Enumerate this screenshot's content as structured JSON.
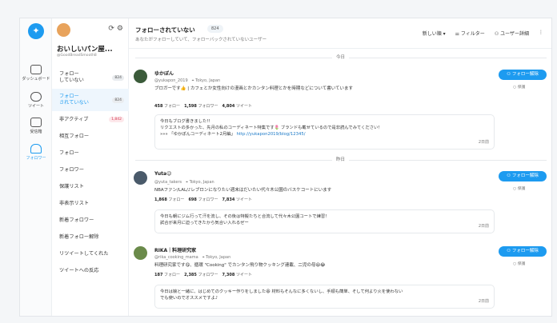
{
  "rail": {
    "logo_icon": "bird-logo-icon",
    "items": [
      {
        "icon": "chart-icon",
        "label": "ダッシュボード"
      },
      {
        "icon": "speech-bubble-icon",
        "label": "ツイート"
      },
      {
        "icon": "inbox-icon",
        "label": "受信箱"
      },
      {
        "icon": "people-icon",
        "label": "フォロワー"
      }
    ]
  },
  "account": {
    "name": "おいしいパン屋...",
    "handle": "@GoodBreadSmooth8",
    "refresh_icon": "refresh-icon",
    "settings_icon": "gear-icon"
  },
  "menu": [
    {
      "label": "フォロー\nしていない",
      "count": "824"
    },
    {
      "label": "フォロー\nされていない",
      "count": "824",
      "active": true
    },
    {
      "label": "非アクティブ",
      "count": "1,842",
      "alert": true
    },
    {
      "label": "相互フォロー"
    },
    {
      "label": "フォロー"
    },
    {
      "label": "フォロワー"
    },
    {
      "label": "保護リスト"
    },
    {
      "label": "非表示リスト"
    },
    {
      "label": "新着フォロワー"
    },
    {
      "label": "新着フォロー解除"
    },
    {
      "label": "リツイートしてくれた"
    },
    {
      "label": "ツイートへの反応"
    }
  ],
  "header": {
    "title": "フォローされていない",
    "count": "824",
    "subtitle": "あなたがフォローしていて、フォローバックされていないユーザー",
    "sort_label": "新しい順 ▾",
    "filter_label": "フィルター",
    "user_detail_label": "ユーザー詳細",
    "more_icon": "vertical-dots-icon"
  },
  "date_labels": [
    "今日",
    "昨日"
  ],
  "users": [
    {
      "name": "ゆかぽん",
      "handle": "@yukapon_2019",
      "location": "Tokyo, Japan",
      "bio": "ブロガーです👍 | カフェとか女性向けの漫画とかカンタン料理とかを時期などについて書いています",
      "following": "458",
      "followers": "1,598",
      "tweets": "4,804",
      "tweet_lines": [
        "今日もブログ書きました!!",
        "リクエストの多かった、先月の私のコーディネート特集です🌷 ブランドも載せているので是非読んでみてください！"
      ],
      "tweet_link_prefix": "»»» 「ゆかぽんコーディネート2月編」",
      "tweet_link": "http://yukapon2019/blog/12345/",
      "tweet_time": "2日前",
      "follow_button": "フォロー解除",
      "keep_label": "保護",
      "avatar_color": "#3b5b3a"
    },
    {
      "name": "Yuta😉",
      "handle": "@yuta_takers",
      "location": "Tokyo, Japan",
      "bio": "NBAファン/LAL/♪レブロンになりたい週末はだいたい代々木公園のバスケコートにいます",
      "following": "1,868",
      "followers": "698",
      "tweets": "7,834",
      "tweet_lines": [
        "今日も朝にジム行って汗を流し、その後は特擬たちと合流して代々木公園コートで練習！",
        "試合が来月に迫ってきたから気合い入れるぜー"
      ],
      "tweet_time": "2日前",
      "follow_button": "フォロー解除",
      "keep_label": "保護",
      "avatar_color": "#4a5a6a"
    },
    {
      "name": "RIKA｜料理研究家",
      "handle": "@rika_cooking_mama",
      "location": "Tokyo, Japan",
      "bio": "料理研究家です😋、循環 \"Cooking\" でカンタン飛り物クッキング連載、二児の母😆😂",
      "following": "187",
      "followers": "2,385",
      "tweets": "7,308",
      "tweet_lines": [
        "今日は娘と一緒に、はじめてのクッキー作りをしました😆 材料もそんなに多くないし、手順も簡単、そして何より火を使わない",
        "でも使いのでオススメですよ♪"
      ],
      "tweet_time": "2日前",
      "follow_button": "フォロー解除",
      "keep_label": "保護",
      "avatar_color": "#6a8a4a"
    }
  ],
  "stat_labels": {
    "following": "フォロー",
    "followers": "フォロワー",
    "tweets": "ツイート"
  },
  "accent_color": "#1d9bf0"
}
